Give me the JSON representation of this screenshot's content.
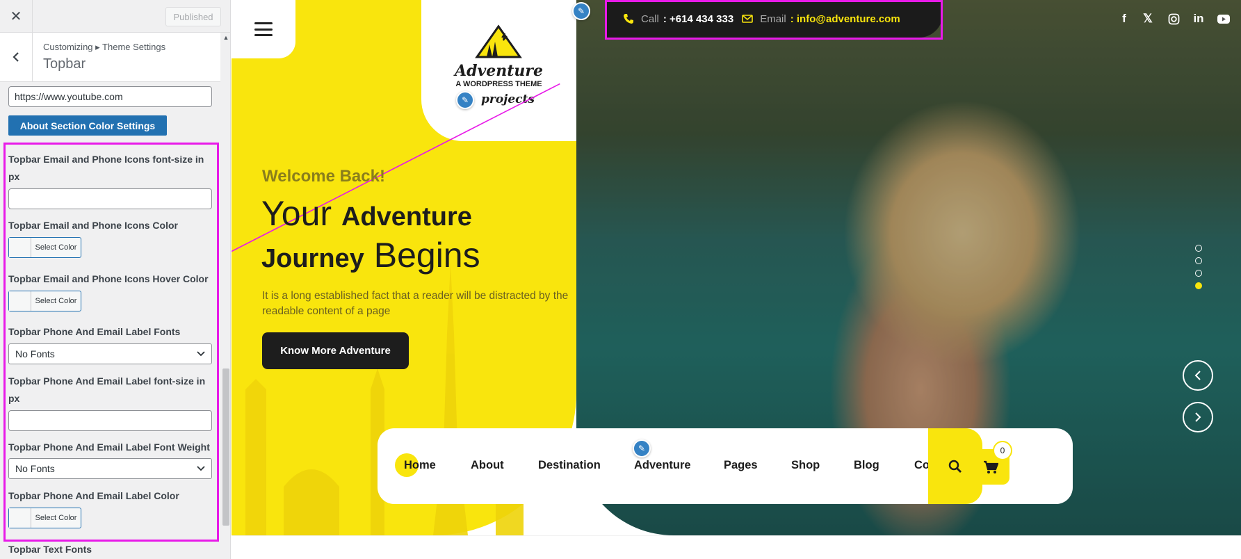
{
  "customizer": {
    "close_icon": "close-icon",
    "published_label": "Published",
    "breadcrumb": "Customizing ▸ Theme Settings",
    "section_title": "Topbar",
    "youtube_url_value": "https://www.youtube.com",
    "about_color_button": "About Section Color Settings",
    "fields": {
      "icon_font_size_label": "Topbar Email and Phone Icons font-size in px",
      "icon_color_label": "Topbar Email and Phone Icons Color",
      "icon_hover_color_label": "Topbar Email and Phone Icons Hover Color",
      "label_fonts_label": "Topbar Phone And Email Label Fonts",
      "label_fonts_value": "No Fonts",
      "label_font_size_label": "Topbar Phone And Email Label font-size in px",
      "label_font_weight_label": "Topbar Phone And Email Label Font Weight",
      "label_font_weight_value": "No Fonts",
      "label_color_label": "Topbar Phone And Email Label Color",
      "text_fonts_label": "Topbar Text Fonts"
    },
    "select_color_label": "Select Color"
  },
  "site": {
    "logo": {
      "title": "Adventure",
      "subtitle": "A WORDPRESS THEME",
      "projects": "projects"
    },
    "topbar": {
      "call_label": "Call",
      "call_value": ": +614 434 333",
      "email_label": "Email",
      "email_value": ": info@adventure.com"
    },
    "social_icons": [
      "facebook-icon",
      "x-icon",
      "instagram-icon",
      "linkedin-icon",
      "youtube-icon"
    ],
    "hero": {
      "welcome": "Welcome Back!",
      "line1_light": "Your",
      "line1_bold": "Adventure",
      "line2_bold": "Journey",
      "line2_light": "Begins",
      "description": "It is a long established fact that a reader will be distracted by the readable content of a page",
      "cta": "Know More Adventure"
    },
    "slider": {
      "dot_count": 4,
      "active_dot": 4
    },
    "nav": {
      "items": [
        "Home",
        "About",
        "Destination",
        "Adventure",
        "Pages",
        "Shop",
        "Blog",
        "Contact"
      ],
      "cart_count": "0"
    }
  },
  "colors": {
    "accent_yellow": "#f9e50d",
    "dark": "#1d1d1d",
    "wp_blue": "#2271b1",
    "highlight_magenta": "#e81ae8"
  }
}
